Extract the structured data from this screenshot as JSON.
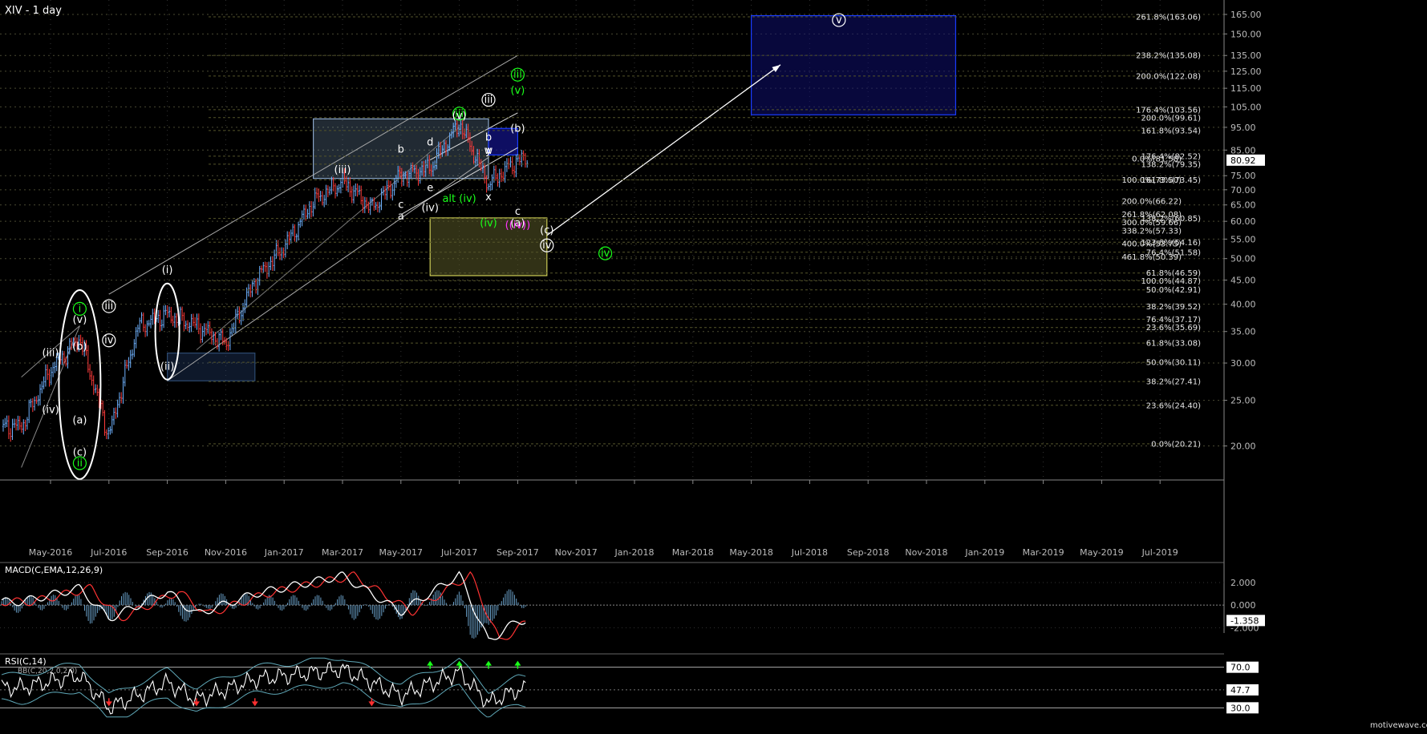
{
  "window": {
    "title": "XIV - 1 day"
  },
  "colors": {
    "accent": "#ffffff",
    "green": "#19ff19",
    "blue": "#1a3cff",
    "magenta": "#ff33ff",
    "yellow": "#cccc55"
  },
  "chart_data": [
    {
      "type": "candlestick",
      "title": "XIV - 1 day",
      "y_scale": "log",
      "ylim": [
        17,
        175
      ],
      "grid": true,
      "x_ticks": [
        "May-2016",
        "Jul-2016",
        "Sep-2016",
        "Nov-2016",
        "Jan-2017",
        "Mar-2017",
        "May-2017",
        "Jul-2017",
        "Sep-2017",
        "Nov-2017",
        "Jan-2018",
        "Mar-2018",
        "May-2018",
        "Jul-2018",
        "Sep-2018",
        "Nov-2018",
        "Jan-2019",
        "Mar-2019",
        "May-2019",
        "Jul-2019"
      ],
      "y_ticks": [
        "165.00",
        "150.00",
        "135.00",
        "125.00",
        "115.00",
        "105.00",
        "95.00",
        "85.00",
        "80.92",
        "75.00",
        "70.00",
        "65.00",
        "60.00",
        "55.00",
        "50.00",
        "45.00",
        "40.00",
        "35.00",
        "30.00",
        "25.00",
        "20.00"
      ],
      "last_price": "80.92",
      "series": [
        {
          "x": [
            "Apr-2016",
            "May-2016",
            "Jun-2016",
            "Jul-2016",
            "Aug-2016",
            "Sep-2016",
            "Oct-2016",
            "Nov-2016",
            "Dec-2016",
            "Jan-2017",
            "Feb-2017",
            "Mar-2017",
            "Apr-2017",
            "May-2017",
            "Jun-2017",
            "Jul-2017",
            "Aug-2017",
            "Sep-2017"
          ],
          "close": [
            22,
            29,
            34,
            21,
            36,
            38,
            36,
            33,
            45,
            53,
            66,
            73,
            64,
            75,
            78,
            97,
            72,
            81
          ]
        }
      ],
      "fib_levels_right": [
        {
          "label": "261.8%(163.06)",
          "value": 163.06
        },
        {
          "label": "238.2%(135.08)",
          "value": 135.08
        },
        {
          "label": "200.0%(122.08)",
          "value": 122.08
        },
        {
          "label": "176.4%(103.56)",
          "value": 103.56
        },
        {
          "label": "200.0%(99.61)",
          "value": 99.61
        },
        {
          "label": "161.8%(93.54)",
          "value": 93.54
        },
        {
          "label": "176.4%(82.52)",
          "value": 82.52
        },
        {
          "label": "138.2%(79.35)",
          "value": 79.35
        },
        {
          "label": "161.8%(73.45)",
          "value": 73.45
        },
        {
          "label": "138.2%(60.85)",
          "value": 60.85
        },
        {
          "label": "123.6%(54.16)",
          "value": 54.16
        },
        {
          "label": "76.4%(51.58)",
          "value": 51.58
        },
        {
          "label": "61.8%(46.59)",
          "value": 46.59
        },
        {
          "label": "100.0%(44.87)",
          "value": 44.87
        },
        {
          "label": "50.0%(42.91)",
          "value": 42.91
        },
        {
          "label": "38.2%(39.52)",
          "value": 39.52
        },
        {
          "label": "76.4%(37.17)",
          "value": 37.17
        },
        {
          "label": "23.6%(35.69)",
          "value": 35.69
        },
        {
          "label": "61.8%(33.08)",
          "value": 33.08
        },
        {
          "label": "50.0%(30.11)",
          "value": 30.11
        },
        {
          "label": "38.2%(27.41)",
          "value": 27.41
        },
        {
          "label": "23.6%(24.40)",
          "value": 24.4
        },
        {
          "label": "0.0%(20.21)",
          "value": 20.21
        }
      ],
      "fib_levels_mid": [
        {
          "label": "0.0%(81.58)",
          "value": 81.58
        },
        {
          "label": "100.0%(73.50)",
          "value": 73.5
        },
        {
          "label": "200.0%(66.22)",
          "value": 66.22
        },
        {
          "label": "261.8%(62.08)",
          "value": 62.08
        },
        {
          "label": "300.0%(59.66)",
          "value": 59.66
        },
        {
          "label": "338.2%(57.33)",
          "value": 57.33
        },
        {
          "label": "400.0%(53.75)",
          "value": 53.75
        },
        {
          "label": "461.8%(50.39)",
          "value": 50.39
        }
      ],
      "wave_labels": [
        {
          "text": "i",
          "date": "Jun-2016",
          "value": 38.5,
          "color": "green"
        },
        {
          "text": "(v)",
          "date": "Jun-2016",
          "value": 36.5,
          "color": "white"
        },
        {
          "text": "(iii)",
          "date": "May-2016",
          "value": 31,
          "color": "white"
        },
        {
          "text": "(iv)",
          "date": "May-2016",
          "value": 23.5,
          "color": "white"
        },
        {
          "text": "(b)",
          "date": "Jun-2016",
          "value": 32,
          "color": "white"
        },
        {
          "text": "(a)",
          "date": "Jun-2016",
          "value": 22.3,
          "color": "white"
        },
        {
          "text": "(c)",
          "date": "Jun-2016",
          "value": 19.1,
          "color": "white"
        },
        {
          "text": "ii",
          "date": "Jun-2016",
          "value": 18.1,
          "color": "green"
        },
        {
          "text": "(i)",
          "date": "Sep-2016",
          "value": 46.5,
          "color": "white"
        },
        {
          "text": "(ii)",
          "date": "Sep-2016",
          "value": 29,
          "color": "white"
        },
        {
          "text": "(iii)",
          "date": "Mar-2017",
          "value": 76,
          "color": "white"
        },
        {
          "text": "(iv)",
          "date": "Jun-2017",
          "value": 63,
          "color": "white"
        },
        {
          "text": "iii",
          "date": "Jul-2017",
          "value": 100,
          "color": "green"
        },
        {
          "text": "(v)",
          "date": "Jul-2017",
          "value": 99,
          "color": "white"
        },
        {
          "text": "iii",
          "date": "Aug-2017",
          "value": 107,
          "color": "white"
        },
        {
          "text": "alt (iv)",
          "date": "Jul-2017",
          "value": 66,
          "color": "green"
        },
        {
          "text": "iii",
          "date": "Sep-2017",
          "value": 121,
          "color": "green"
        },
        {
          "text": "(v)",
          "date": "Sep-2017",
          "value": 112,
          "color": "green"
        },
        {
          "text": "(b)",
          "date": "Sep-2017",
          "value": 93,
          "color": "white"
        },
        {
          "text": "(iv)",
          "date": "Aug-2017",
          "value": 58.5,
          "color": "green"
        },
        {
          "text": "(a)",
          "date": "Sep-2017",
          "value": 58.5,
          "color": "white"
        },
        {
          "text": "((iv))",
          "date": "Sep-2017",
          "value": 58,
          "color": "magenta"
        },
        {
          "text": "(c)",
          "date": "Oct-2017",
          "value": 56.5,
          "color": "white"
        },
        {
          "text": "iv",
          "date": "Oct-2017",
          "value": 52.5,
          "color": "white"
        },
        {
          "text": "iv",
          "date": "Dec-2017",
          "value": 50.5,
          "color": "green"
        },
        {
          "text": "v",
          "date": "Aug-2018",
          "value": 158,
          "color": "white"
        },
        {
          "text": "iii",
          "date": "Jul-2016",
          "value": 39,
          "color": "white"
        },
        {
          "text": "iv",
          "date": "Jul-2016",
          "value": 33,
          "color": "white"
        },
        {
          "text": "a",
          "date": "May-2017",
          "value": 60.5,
          "color": "white"
        },
        {
          "text": "b",
          "date": "May-2017",
          "value": 84,
          "color": "white"
        },
        {
          "text": "c",
          "date": "May-2017",
          "value": 64,
          "color": "white"
        },
        {
          "text": "d",
          "date": "Jun-2017",
          "value": 87,
          "color": "white"
        },
        {
          "text": "e",
          "date": "Jun-2017",
          "value": 69.5,
          "color": "white"
        },
        {
          "text": "w",
          "date": "Aug-2017",
          "value": 83.5,
          "color": "white"
        },
        {
          "text": "x",
          "date": "Aug-2017",
          "value": 66.5,
          "color": "white"
        },
        {
          "text": "y",
          "date": "Aug-2017",
          "value": 83.5,
          "color": "white"
        },
        {
          "text": "b",
          "date": "Aug-2017",
          "value": 89,
          "color": "white"
        },
        {
          "text": "c",
          "date": "Sep-2017",
          "value": 62,
          "color": "white"
        }
      ]
    },
    {
      "type": "line",
      "title": "MACD(C,EMA,12,26,9)",
      "y_ticks": [
        "2.000",
        "0.000",
        "-2.000"
      ],
      "last_value": "-1.358",
      "series": [
        {
          "name": "MACD",
          "x": [
            "Apr-2016",
            "Jun-2016",
            "Jul-2016",
            "Sep-2016",
            "Oct-2016",
            "Dec-2016",
            "Mar-2017",
            "May-2017",
            "Jul-2017",
            "Aug-2017",
            "Sep-2017"
          ],
          "values": [
            0.3,
            1.5,
            -1.2,
            1.2,
            -0.8,
            1.0,
            2.6,
            -0.6,
            2.7,
            -3.2,
            -1.358
          ]
        }
      ]
    },
    {
      "type": "line",
      "title": "RSI(C,14)",
      "subtitle": "BB(C,20,2,0,2.0)",
      "y_ticks": [
        "70.0",
        "47.7",
        "30.0"
      ],
      "last_value": "47.7",
      "series": [
        {
          "name": "RSI",
          "x": [
            "Apr-2016",
            "Jun-2016",
            "Jul-2016",
            "Sep-2016",
            "Oct-2016",
            "Dec-2016",
            "Mar-2017",
            "May-2017",
            "Jul-2017",
            "Aug-2017",
            "Sep-2017"
          ],
          "values": [
            50,
            62,
            30,
            55,
            38,
            58,
            68,
            42,
            65,
            35,
            47.7
          ]
        }
      ]
    }
  ],
  "footer": {
    "watermark": "motivewave.com"
  }
}
